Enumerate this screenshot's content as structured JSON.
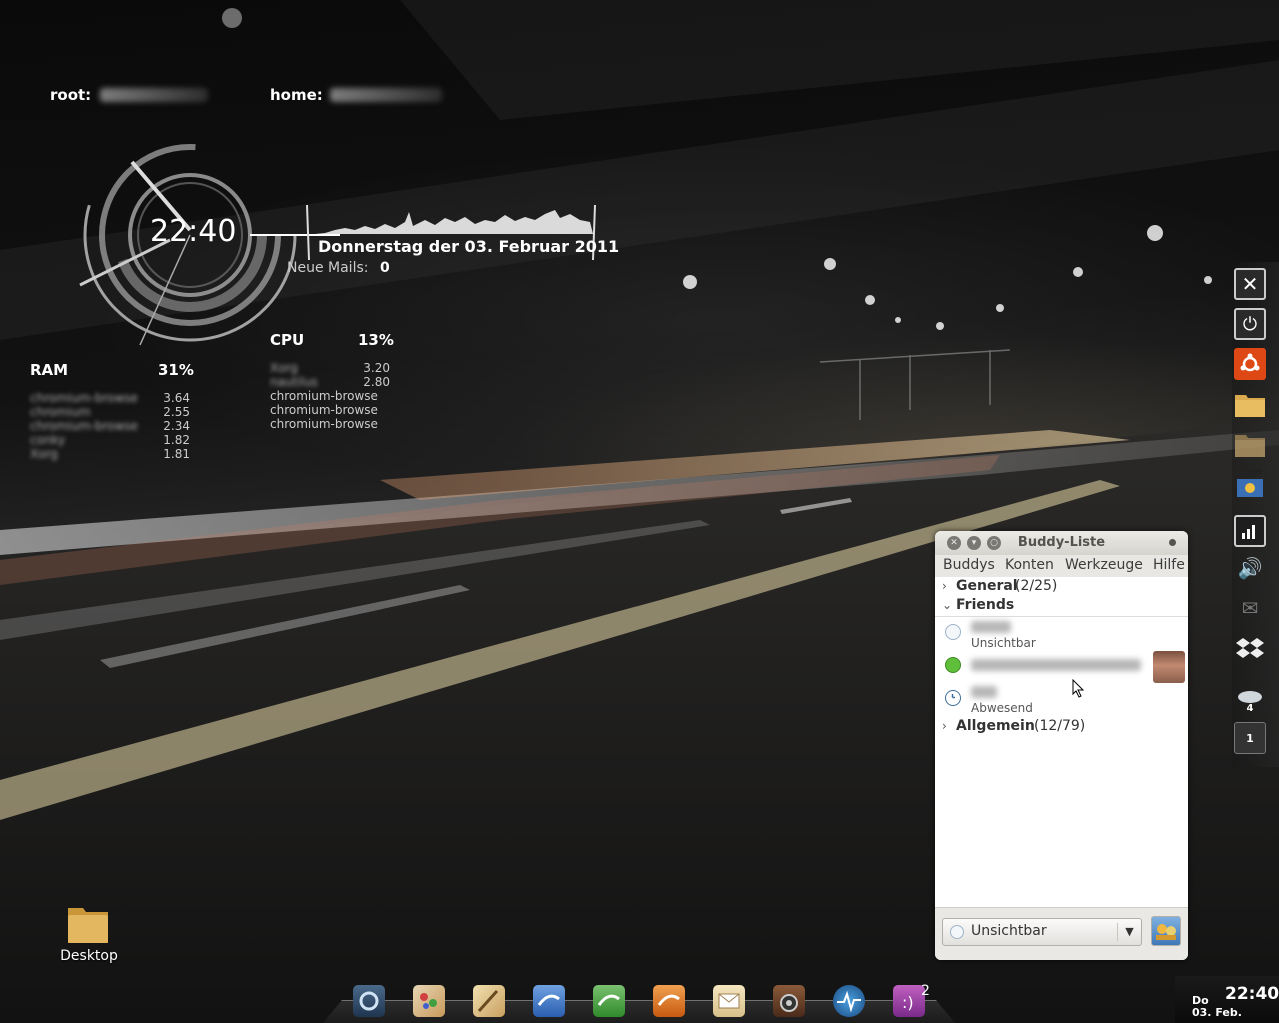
{
  "conky": {
    "root_label": "root:",
    "home_label": "home:",
    "clock_time": "22:40",
    "date": "Donnerstag der 03. Februar 2011",
    "mails_label": "Neue Mails:",
    "mails_count": "0",
    "cpu": {
      "label": "CPU",
      "percent": "13%",
      "processes": [
        {
          "name": "Xorg",
          "value": "3.20",
          "blurred": true
        },
        {
          "name": "nautilus",
          "value": "2.80",
          "blurred": true
        },
        {
          "name": "chromium-browse",
          "value": "",
          "blurred": false
        },
        {
          "name": "chromium-browse",
          "value": "",
          "blurred": false
        },
        {
          "name": "chromium-browse",
          "value": "",
          "blurred": false
        }
      ]
    },
    "ram": {
      "label": "RAM",
      "percent": "31%",
      "processes": [
        {
          "name": "chromium-browse",
          "value": "3.64",
          "blurred": true
        },
        {
          "name": "chromium",
          "value": "2.55",
          "blurred": true
        },
        {
          "name": "chromium-browse",
          "value": "2.34",
          "blurred": true
        },
        {
          "name": "conky",
          "value": "1.82",
          "blurred": true
        },
        {
          "name": "Xorg",
          "value": "1.81",
          "blurred": true
        }
      ]
    }
  },
  "buddy_list": {
    "title": "Buddy-Liste",
    "menu": [
      "Buddys",
      "Konten",
      "Werkzeuge",
      "Hilfe"
    ],
    "groups": {
      "general": {
        "name": "General",
        "count": "(2/25)"
      },
      "friends": {
        "name": "Friends"
      },
      "allgemein": {
        "name": "Allgemein",
        "count": "(12/79)"
      }
    },
    "buddies": [
      {
        "status": "Unsichtbar",
        "state": "invisible"
      },
      {
        "status": "",
        "state": "available"
      },
      {
        "status": "Abwesend",
        "state": "away"
      }
    ],
    "current_status": "Unsichtbar"
  },
  "desktop": {
    "icon_label": "Desktop"
  },
  "tray": {
    "day": "Do",
    "date": "03. Feb.",
    "time": "22:40"
  },
  "dock": {
    "badge_count": "2",
    "side_badge_1": "4",
    "side_badge_2": "1"
  },
  "colors": {
    "ubuntu_orange": "#dd4814",
    "folder_tan": "#d9a94d",
    "available_green": "#5fbf3a"
  },
  "icons": {
    "side_dock": [
      "close-icon",
      "power-icon",
      "ubuntu-icon",
      "folder-icon",
      "folder-icon",
      "clapper-icon",
      "signal-icon",
      "speaker-icon",
      "mail-icon",
      "dropbox-icon",
      "weather-icon",
      "workspace-icon"
    ],
    "bottom_dock": [
      "screenshot-icon",
      "image-viewer-icon",
      "draw-icon",
      "writer-icon",
      "calc-icon",
      "impress-icon",
      "mail-client-icon",
      "speaker-app-icon",
      "system-monitor-icon",
      "pidgin-icon"
    ]
  }
}
